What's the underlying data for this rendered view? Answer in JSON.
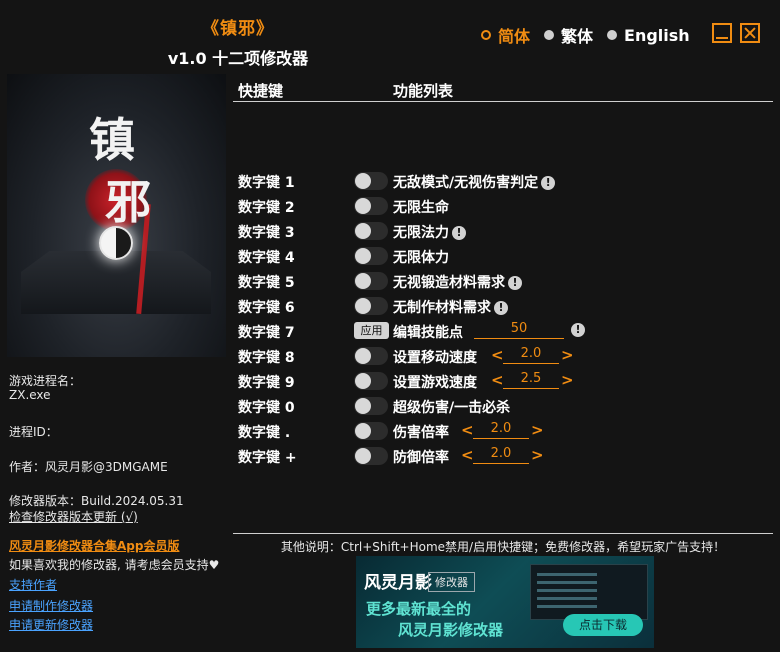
{
  "title": {
    "game": "《镇邪》",
    "subtitle": "v1.0 十二项修改器"
  },
  "languages": [
    {
      "label": "简体",
      "selected": true
    },
    {
      "label": "繁体",
      "selected": false
    },
    {
      "label": "English",
      "selected": false
    }
  ],
  "cover": {
    "chars": [
      "镇",
      "邪"
    ]
  },
  "info": {
    "process_label": "游戏进程名：",
    "process_value": "ZX.exe",
    "pid_label": "进程ID：",
    "author": "作者：风灵月影@3DMGAME",
    "version": "修改器版本：Build.2024.05.31",
    "check_update": "检查修改器版本更新 (√)",
    "promo": "风灵月影修改器合集App会员版",
    "support_note": "如果喜欢我的修改器, 请考虑会员支持♥",
    "support_author": "支持作者",
    "request_make": "申请制作修改器",
    "request_update": "申请更新修改器"
  },
  "headers": {
    "hotkey": "快捷键",
    "features": "功能列表"
  },
  "features": [
    {
      "hotkey": "数字键 1",
      "name": "无敌模式/无视伤害判定",
      "warn": "!"
    },
    {
      "hotkey": "数字键 2",
      "name": "无限生命"
    },
    {
      "hotkey": "数字键 3",
      "name": "无限法力",
      "warn": "!"
    },
    {
      "hotkey": "数字键 4",
      "name": "无限体力"
    },
    {
      "hotkey": "数字键 5",
      "name": "无视锻造材料需求",
      "warn": "!"
    },
    {
      "hotkey": "数字键 6",
      "name": "无制作材料需求",
      "warn": "!"
    },
    {
      "hotkey": "数字键 7",
      "name": "编辑技能点",
      "apply_label": "应用",
      "value": "50",
      "warn": "!"
    },
    {
      "hotkey": "数字键 8",
      "name": "设置移动速度",
      "value": "2.0",
      "left": "<",
      "right": ">"
    },
    {
      "hotkey": "数字键 9",
      "name": "设置游戏速度",
      "value": "2.5",
      "left": "<",
      "right": ">"
    },
    {
      "hotkey": "数字键 0",
      "name": "超级伤害/一击必杀"
    },
    {
      "hotkey": "数字键 .",
      "name": "伤害倍率",
      "value": "2.0",
      "left": "<",
      "right": ">"
    },
    {
      "hotkey": "数字键 +",
      "name": "防御倍率",
      "value": "2.0",
      "left": "<",
      "right": ">"
    }
  ],
  "footer": {
    "note": "其他说明：Ctrl+Shift+Home禁用/启用快捷键；免费修改器，希望玩家广告支持！"
  },
  "banner": {
    "logo": "风灵月影",
    "tag": "修改器",
    "line1": "更多最新最全的",
    "line2": "风灵月影修改器",
    "download": "点击下载"
  },
  "colors": {
    "accent": "#f08c12",
    "link": "#4aa3ff",
    "background": "#141414"
  }
}
